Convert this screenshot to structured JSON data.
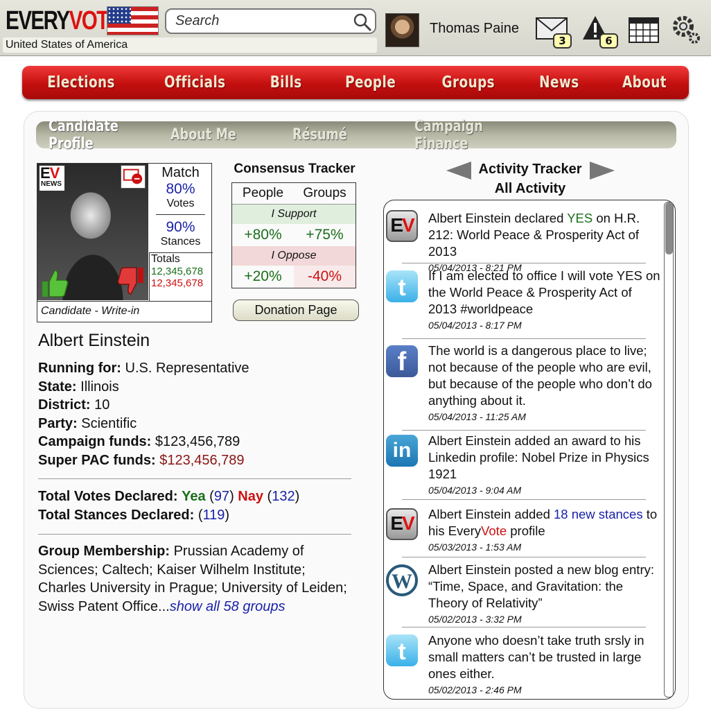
{
  "app": {
    "logo_every": "EVERY",
    "logo_vote": "VOTE",
    "country": "United States of America"
  },
  "search": {
    "placeholder": "Search"
  },
  "user": {
    "name": "Thomas Paine",
    "messages_count": "3",
    "alerts_count": "6"
  },
  "nav": [
    "Elections",
    "Officials",
    "Bills",
    "People",
    "Groups",
    "News",
    "About"
  ],
  "tabs": [
    "Candidate Profile",
    "About Me",
    "Résumé",
    "Campaign Finance"
  ],
  "card": {
    "ev": "E",
    "ev_v": "V",
    "news": "NEWS",
    "match_title": "Match",
    "votes_pct": "80%",
    "votes_label": "Votes",
    "stances_pct": "90%",
    "stances_label": "Stances",
    "totals_label": "Totals",
    "totals_up": "12,345,678",
    "totals_down": "12,345,678",
    "footer": "Candidate - Write-in"
  },
  "consensus": {
    "title": "Consensus Tracker",
    "col1": "People",
    "col2": "Groups",
    "support": "I Support",
    "support_people": "+80%",
    "support_groups": "+75%",
    "oppose": "I Oppose",
    "oppose_people": "+20%",
    "oppose_groups": "-40%",
    "donation": "Donation Page"
  },
  "candidate": {
    "name": "Albert Einstein",
    "running_label": "Running for:",
    "running": "U.S. Representative",
    "state_label": "State:",
    "state": "Illinois",
    "district_label": "District:",
    "district": "10",
    "party_label": "Party:",
    "party": "Scientific",
    "funds_label": "Campaign funds:",
    "funds": "$123,456,789",
    "pac_label": "Super PAC funds:",
    "pac": "$123,456,789",
    "votes_label": "Total Votes Declared:",
    "yea": "Yea",
    "yea_count": "97",
    "nay": "Nay",
    "nay_count": "132",
    "stances_label": "Total Stances Declared:",
    "stances_count": "119",
    "groups_label": "Group Membership:",
    "groups": "Prussian Academy of Sciences; Caltech; Kaiser Wilhelm Institute; Charles University in Prague; University of Leiden; Swiss Patent Office...",
    "groups_link": "show all 58 groups"
  },
  "activity": {
    "title": "Activity Tracker",
    "subtitle": "All Activity",
    "items": [
      {
        "icon": "everyvote-icon",
        "pre": "Albert Einstein declared ",
        "hl": "YES",
        "post": " on H.R. 212: World Peace & Prosperity Act of 2013",
        "ts": "05/04/2013 - 8:21 PM"
      },
      {
        "icon": "twitter-icon",
        "text": "If I am elected to office I will vote YES on the World Peace & Prosperity Act of 2013 #worldpeace",
        "ts": "05/04/2013 - 8:17 PM"
      },
      {
        "icon": "facebook-icon",
        "text": "The world is a dangerous place to live; not because of the people who are evil, but because of the people who don’t do anything about it.",
        "ts": "05/04/2013 - 11:25 AM"
      },
      {
        "icon": "linkedin-icon",
        "text": "Albert Einstein added an award to his Linkedin profile: Nobel Prize in Physics 1921",
        "ts": "05/04/2013 - 9:04 AM"
      },
      {
        "icon": "everyvote-icon",
        "pre": "Albert Einstein added ",
        "link": "18 new stances",
        "mid": " to his Every",
        "vote": "Vote",
        "post": " profile",
        "ts": "05/03/2013 - 1:53 AM"
      },
      {
        "icon": "wordpress-icon",
        "text": "Albert Einstein posted a new blog entry: “Time, Space, and Gravitation: the Theory of Relativity”",
        "ts": "05/02/2013 - 3:32 PM"
      },
      {
        "icon": "twitter-icon",
        "text": "Anyone who doesn’t take truth srsly in small matters can’t be trusted in large ones either.",
        "ts": "05/02/2013 - 2:46 PM"
      }
    ]
  },
  "colors": {
    "nav_red": "#c40f0f",
    "brand_red": "#d11",
    "link_blue": "#1a22a8",
    "positive_green": "#1a6e1a"
  }
}
